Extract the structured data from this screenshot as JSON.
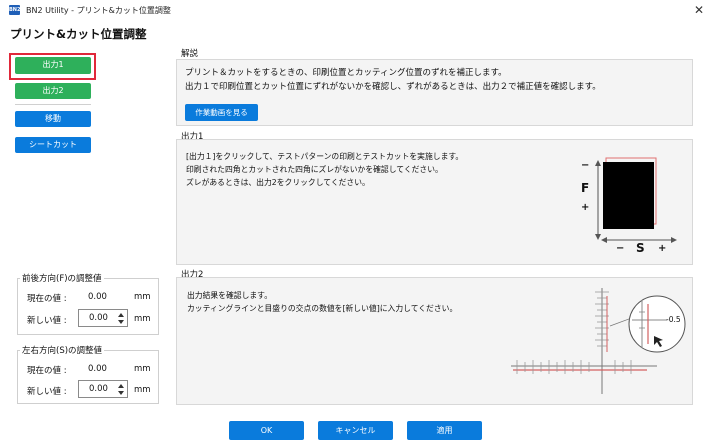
{
  "window": {
    "app_icon_text": "BN2",
    "title": "BN2 Utility - プリント&カット位置調整",
    "close_glyph": "✕"
  },
  "page_title": "プリント&カット位置調整",
  "left": {
    "output1": "出力1",
    "output2": "出力2",
    "move": "移動",
    "sheet_cut": "シートカット"
  },
  "feed_group": {
    "legend": "前後方向(F)の調整値",
    "current_label": "現在の値 :",
    "current_value": "0.00",
    "current_unit": "mm",
    "new_label": "新しい値 :",
    "new_value": "0.00",
    "new_unit": "mm"
  },
  "scan_group": {
    "legend": "左右方向(S)の調整値",
    "current_label": "現在の値 :",
    "current_value": "0.00",
    "current_unit": "mm",
    "new_label": "新しい値 :",
    "new_value": "0.00",
    "new_unit": "mm"
  },
  "explanation": {
    "title": "解説",
    "line1": "プリント＆カットをするときの、印刷位置とカッティング位置のずれを補正します。",
    "line2": "出力１で印刷位置とカット位置にずれがないかを確認し、ずれがあるときは、出力２で補正値を確認します。",
    "video_button": "作業動画を見る"
  },
  "output1_panel": {
    "title": "出力1",
    "line1": "[出力１]をクリックして、テストパターンの印刷とテストカットを実施します。",
    "line2": "印刷された四角とカットされた四角にズレがないかを確認してください。",
    "line3": "ズレがあるときは、出力2をクリックしてください。",
    "diagram": {
      "minus_top": "−",
      "f_label": "F",
      "plus_bottom": "+",
      "minus_left": "−",
      "s_label": "S",
      "plus_right": "+"
    }
  },
  "output2_panel": {
    "title": "出力2",
    "line1": "出力結果を確認します。",
    "line2": "カッティングラインと目盛りの交点の数値を[新しい値]に入力してください。",
    "magnified_value": "-0.5"
  },
  "footer": {
    "ok": "OK",
    "cancel": "キャンセル",
    "apply": "適用"
  },
  "colors": {
    "green": "#2eb05b",
    "blue": "#0a7bdc",
    "highlight_red": "#e0283a"
  }
}
